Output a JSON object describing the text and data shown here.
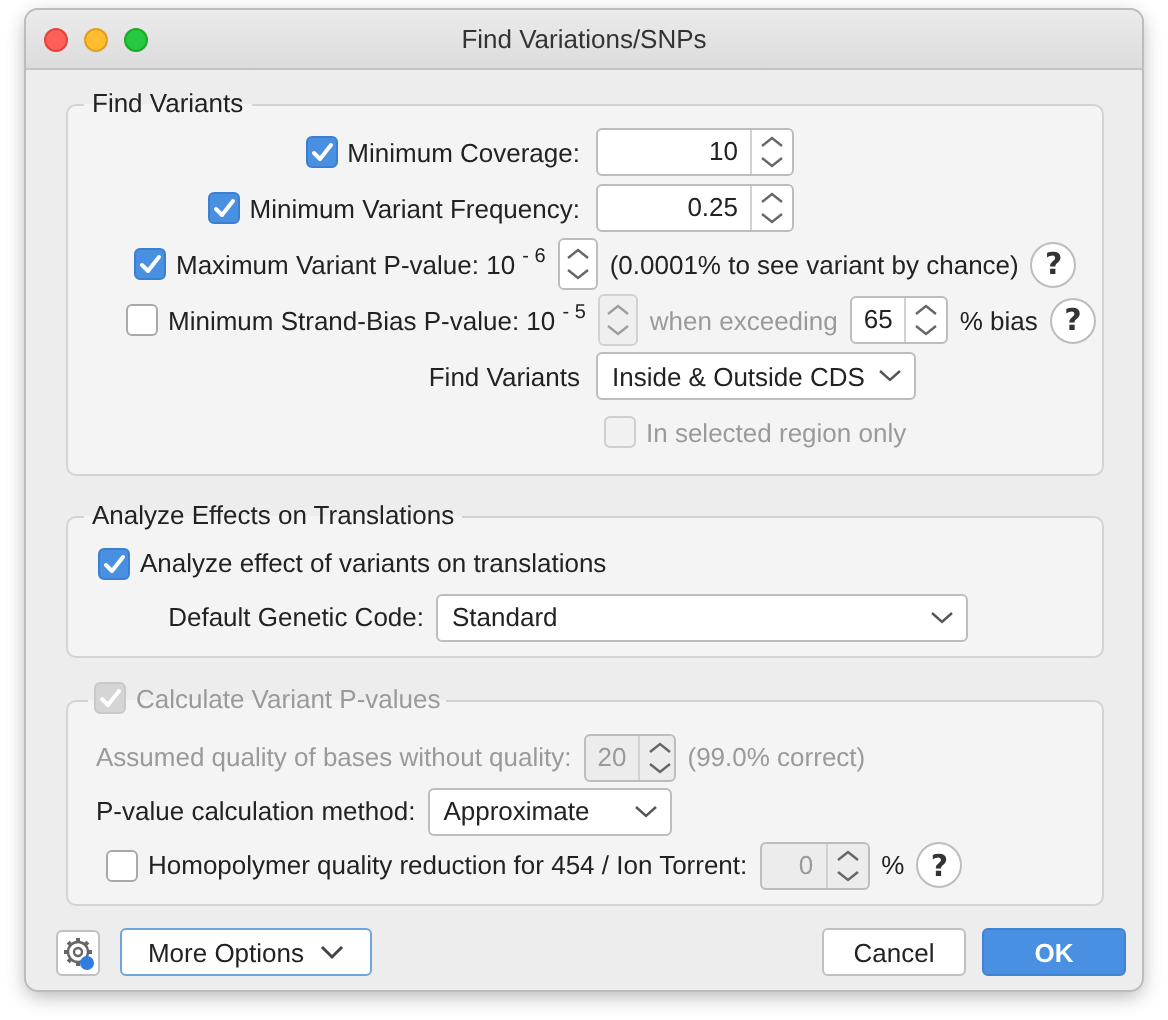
{
  "window": {
    "title": "Find Variations/SNPs"
  },
  "groups": [
    {
      "legend": {
        "kind": "text",
        "text": "Find Variants"
      },
      "rows": [
        {
          "items": [
            {
              "kind": "check",
              "checked": true,
              "disabled": false,
              "label": "Minimum Coverage:"
            },
            {
              "kind": "spin",
              "value": "10",
              "disabled": false
            }
          ]
        },
        {
          "items": [
            {
              "kind": "check",
              "checked": true,
              "disabled": false,
              "label": "Minimum Variant Frequency:"
            },
            {
              "kind": "spin",
              "value": "0.25",
              "disabled": false
            }
          ]
        },
        {
          "items": [
            {
              "kind": "check",
              "checked": true,
              "disabled": false,
              "label": "Maximum Variant P-value: 10 $^{- 6}$"
            },
            {
              "kind": "stepper",
              "disabled": false
            },
            {
              "kind": "label",
              "text": "(0.0001% to see variant by chance)",
              "disabled": false
            },
            {
              "kind": "help",
              "text": "?"
            }
          ]
        },
        {
          "items": [
            {
              "kind": "check",
              "checked": false,
              "disabled": false,
              "label": "Minimum Strand-Bias P-value: 10 $^{- 5}$"
            },
            {
              "kind": "stepper",
              "disabled": true
            },
            {
              "kind": "label",
              "text": "when exceeding",
              "disabled": true
            },
            {
              "kind": "spin",
              "value": "65",
              "disabled": false
            },
            {
              "kind": "label",
              "text": "% bias",
              "disabled": false
            },
            {
              "kind": "help",
              "text": "?"
            }
          ]
        },
        {
          "items": [
            {
              "kind": "label",
              "text": "Find Variants",
              "disabled": false
            },
            {
              "kind": "select",
              "value": "Inside & Outside CDS"
            }
          ]
        },
        {
          "items": [
            {
              "kind": "check",
              "checked": false,
              "disabled": true,
              "label": "In selected region only"
            }
          ]
        }
      ]
    },
    {
      "legend": {
        "kind": "text",
        "text": "Analyze Effects on Translations"
      },
      "rows": [
        {
          "items": [
            {
              "kind": "check",
              "checked": true,
              "disabled": false,
              "label": "Analyze effect of variants on translations"
            }
          ]
        },
        {
          "items": [
            {
              "kind": "label",
              "text": "Default Genetic Code:",
              "disabled": false
            },
            {
              "kind": "select",
              "value": "Standard"
            }
          ]
        }
      ]
    },
    {
      "legend": {
        "kind": "check",
        "checked": true,
        "disabled": true,
        "label": "Calculate Variant P-values"
      },
      "rows": [
        {
          "items": [
            {
              "kind": "label",
              "text": "Assumed quality of bases without quality:",
              "disabled": true
            },
            {
              "kind": "spin",
              "value": "20",
              "disabled": true
            },
            {
              "kind": "label",
              "text": "(99.0% correct)",
              "disabled": true
            }
          ]
        },
        {
          "items": [
            {
              "kind": "label",
              "text": "P-value calculation method:",
              "disabled": false
            },
            {
              "kind": "select",
              "value": "Approximate"
            }
          ]
        },
        {
          "items": [
            {
              "kind": "check",
              "checked": false,
              "disabled": false,
              "label": "Homopolymer quality reduction for 454 / Ion Torrent:"
            },
            {
              "kind": "spin",
              "value": "0",
              "disabled": true
            },
            {
              "kind": "label",
              "text": "%",
              "disabled": false
            },
            {
              "kind": "help",
              "text": "?"
            }
          ]
        }
      ]
    }
  ],
  "footer": {
    "left": [
      {
        "kind": "settings"
      },
      {
        "kind": "menu",
        "label": "More Options"
      }
    ],
    "right": [
      {
        "kind": "plain",
        "label": "Cancel"
      },
      {
        "kind": "default",
        "label": "OK"
      }
    ]
  }
}
